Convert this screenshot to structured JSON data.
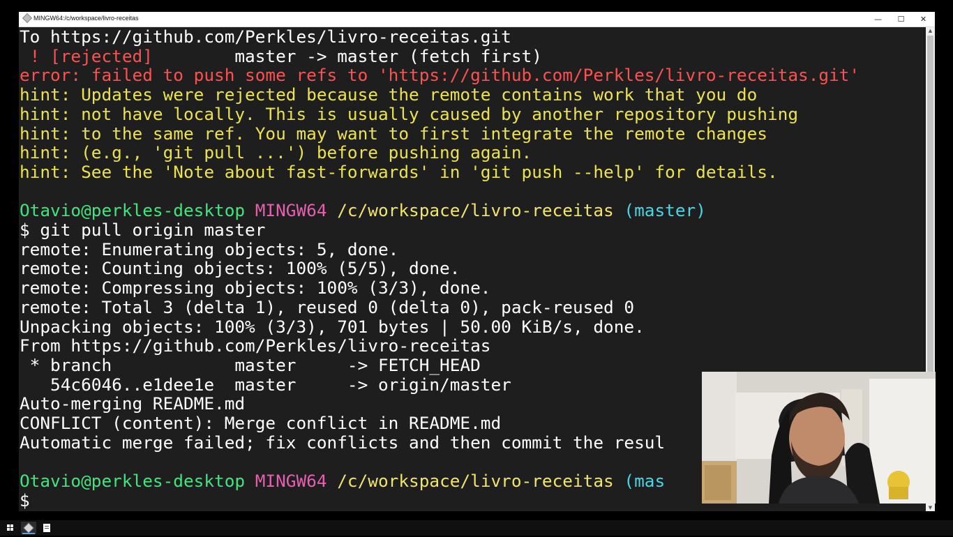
{
  "window": {
    "title": "MINGW64:/c/workspace/livro-receitas",
    "minimize": "—",
    "maximize": "☐",
    "close": "✕"
  },
  "terminal": {
    "lines": [
      [
        {
          "t": "To https://github.com/Perkles/livro-receitas.git",
          "c": "white"
        }
      ],
      [
        {
          "t": " ! [rejected]        ",
          "c": "red"
        },
        {
          "t": "master -> master (fetch first)",
          "c": "white"
        }
      ],
      [
        {
          "t": "error: failed to push some refs to 'https://github.com/Perkles/livro-receitas.git'",
          "c": "red"
        }
      ],
      [
        {
          "t": "hint: Updates were rejected because the remote contains work that you do",
          "c": "yellow"
        }
      ],
      [
        {
          "t": "hint: not have locally. This is usually caused by another repository pushing",
          "c": "yellow"
        }
      ],
      [
        {
          "t": "hint: to the same ref. You may want to first integrate the remote changes",
          "c": "yellow"
        }
      ],
      [
        {
          "t": "hint: (e.g., 'git pull ...') before pushing again.",
          "c": "yellow"
        }
      ],
      [
        {
          "t": "hint: See the 'Note about fast-forwards' in 'git push --help' for details.",
          "c": "yellow"
        }
      ],
      [],
      [
        {
          "t": "Otavio@perkles-desktop ",
          "c": "green"
        },
        {
          "t": "MINGW64 ",
          "c": "magenta"
        },
        {
          "t": "/c/workspace/livro-receitas ",
          "c": "ylw"
        },
        {
          "t": "(master)",
          "c": "cyan"
        }
      ],
      [
        {
          "t": "$ git pull origin master",
          "c": "white"
        }
      ],
      [
        {
          "t": "remote: Enumerating objects: 5, done.",
          "c": "white"
        }
      ],
      [
        {
          "t": "remote: Counting objects: 100% (5/5), done.",
          "c": "white"
        }
      ],
      [
        {
          "t": "remote: Compressing objects: 100% (3/3), done.",
          "c": "white"
        }
      ],
      [
        {
          "t": "remote: Total 3 (delta 1), reused 0 (delta 0), pack-reused 0",
          "c": "white"
        }
      ],
      [
        {
          "t": "Unpacking objects: 100% (3/3), 701 bytes | 50.00 KiB/s, done.",
          "c": "white"
        }
      ],
      [
        {
          "t": "From https://github.com/Perkles/livro-receitas",
          "c": "white"
        }
      ],
      [
        {
          "t": " * branch            master     -> FETCH_HEAD",
          "c": "white"
        }
      ],
      [
        {
          "t": "   54c6046..e1dee1e  master     -> origin/master",
          "c": "white"
        }
      ],
      [
        {
          "t": "Auto-merging README.md",
          "c": "white"
        }
      ],
      [
        {
          "t": "CONFLICT (content): Merge conflict in README.md",
          "c": "white"
        }
      ],
      [
        {
          "t": "Automatic merge failed; fix conflicts and then commit the resul",
          "c": "white"
        }
      ],
      [],
      [
        {
          "t": "Otavio@perkles-desktop ",
          "c": "green"
        },
        {
          "t": "MINGW64 ",
          "c": "magenta"
        },
        {
          "t": "/c/workspace/livro-receitas ",
          "c": "ylw"
        },
        {
          "t": "(mas",
          "c": "cyan"
        }
      ],
      [
        {
          "t": "$",
          "c": "white"
        }
      ]
    ]
  },
  "taskbar": {
    "items": [
      "windows-start-icon",
      "git-bash-taskbar-icon",
      "notepad-taskbar-icon"
    ]
  }
}
